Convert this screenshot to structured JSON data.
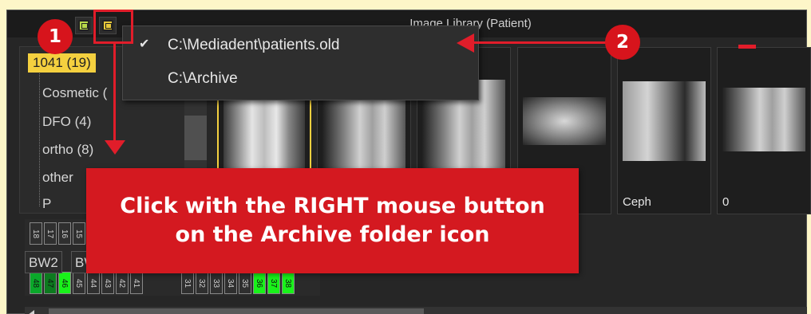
{
  "window": {
    "title": "Image Library (Patient)"
  },
  "toolbar": {
    "green_icon": "folder-icon",
    "archive_icon": "archive-folder-icon"
  },
  "tree": {
    "items": [
      {
        "label": "1041 (19)",
        "selected": true
      },
      {
        "label": "Cosmetic ("
      },
      {
        "label": "DFO (4)"
      },
      {
        "label": "ortho (8)"
      },
      {
        "label": "other"
      },
      {
        "label": "P"
      }
    ]
  },
  "thumbnails": [
    {
      "caption": "",
      "selected": true
    },
    {
      "caption": ""
    },
    {
      "caption": ""
    },
    {
      "caption": ""
    },
    {
      "caption": "Ceph"
    },
    {
      "caption": "0"
    }
  ],
  "teeth": {
    "upper_left": [
      "18",
      "17",
      "16",
      "15"
    ],
    "lower_left": [
      "48",
      "47",
      "46",
      "45",
      "44",
      "43",
      "42",
      "41"
    ],
    "lower_right": [
      "31",
      "32",
      "33",
      "34",
      "35",
      "36",
      "37",
      "38"
    ],
    "bw_labels": [
      "BW2",
      "BW"
    ]
  },
  "menu": {
    "items": [
      {
        "label": "C:\\Mediadent\\patients.old",
        "checked": true,
        "check": "✔"
      },
      {
        "label": "C:\\Archive",
        "checked": false,
        "check": ""
      }
    ]
  },
  "annotations": {
    "badge1": "1",
    "badge2": "2",
    "callout_line1": "Click with the RIGHT mouse button",
    "callout_line2": "on the Archive folder icon"
  },
  "colors": {
    "accent": "#f4d03f",
    "annotation": "#e11d2a",
    "background": "#fdf6c8"
  }
}
